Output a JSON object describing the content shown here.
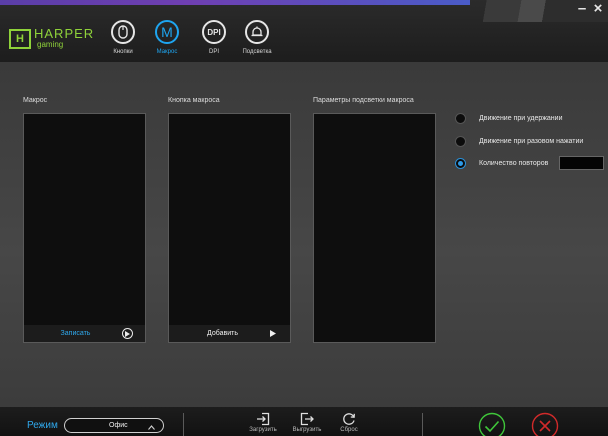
{
  "window": {
    "minimize_label": "–",
    "close_label": "×"
  },
  "logo": {
    "badge": "H",
    "title": "HARPER",
    "subtitle": "gaming"
  },
  "nav": {
    "buttons_label": "Кнопки",
    "macro_label": "Макрос",
    "macro_glyph": "M",
    "dpi_label": "DPI",
    "dpi_glyph": "DPI",
    "lighting_label": "Подсветка",
    "active": "macro",
    "active_color": "#1ea5f0"
  },
  "panels": {
    "macro_title": "Макрос",
    "macro_record_label": "Записать",
    "button_title": "Кнопка макроса",
    "button_add_label": "Добавить",
    "lighting_title": "Параметры подсветки макроса"
  },
  "options": {
    "hold_label": "Движение при удержании",
    "single_press_label": "Движение при разовом нажатии",
    "repeat_label": "Количество повторов",
    "repeat_value": "",
    "selected": "repeat"
  },
  "bottom": {
    "mode_label": "Режим",
    "mode_value": "Офис",
    "load_label": "Загрузить",
    "save_label": "Выгрузить",
    "reset_label": "Сброс",
    "confirm_color": "#3fc63a",
    "cancel_color": "#d12a2a"
  }
}
